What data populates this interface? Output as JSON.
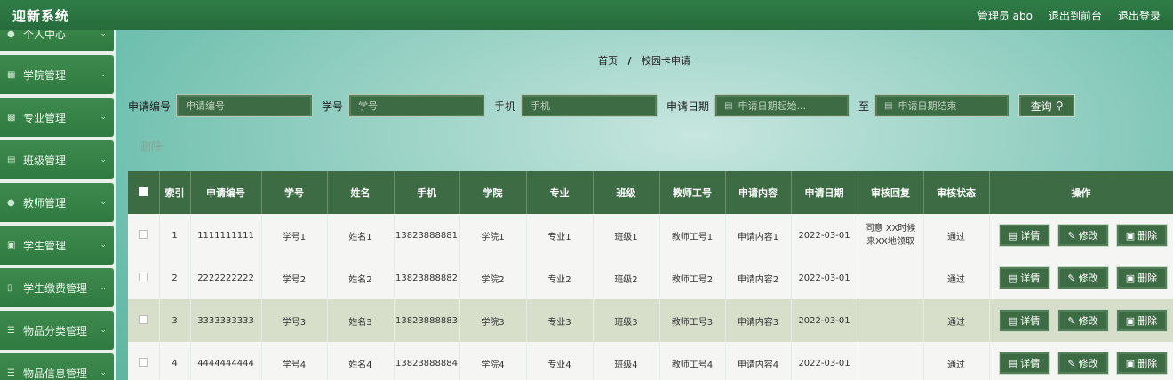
{
  "header": {
    "app_title": "迎新系统",
    "admin_label": "管理员 abo",
    "exit_front": "退出到前台",
    "logout": "退出登录"
  },
  "sidebar": {
    "items": [
      {
        "label": "个人中心",
        "icon": "user-icon"
      },
      {
        "label": "学院管理",
        "icon": "grid-icon"
      },
      {
        "label": "专业管理",
        "icon": "clipboard-icon"
      },
      {
        "label": "班级管理",
        "icon": "list-icon"
      },
      {
        "label": "教师管理",
        "icon": "user-icon"
      },
      {
        "label": "学生管理",
        "icon": "chat-icon"
      },
      {
        "label": "学生缴费管理",
        "icon": "bar-chart-icon"
      },
      {
        "label": "物品分类管理",
        "icon": "menu-icon"
      },
      {
        "label": "物品信息管理",
        "icon": "menu-icon"
      }
    ]
  },
  "breadcrumb": {
    "home": "首页",
    "sep": "/",
    "current": "校园卡申请"
  },
  "search": {
    "app_no_label": "申请编号",
    "app_no_placeholder": "申请编号",
    "student_no_label": "学号",
    "student_no_placeholder": "学号",
    "phone_label": "手机",
    "phone_placeholder": "手机",
    "date_label": "申请日期",
    "date_start_placeholder": "申请日期起始...",
    "to_label": "至",
    "date_end_placeholder": "申请日期结束",
    "query_button": "查询"
  },
  "actions": {
    "delete_label": "删除"
  },
  "table": {
    "columns": [
      "索引",
      "申请编号",
      "学号",
      "姓名",
      "手机",
      "学院",
      "专业",
      "班级",
      "教师工号",
      "申请内容",
      "申请日期",
      "审核回复",
      "审核状态",
      "操作"
    ],
    "rows": [
      {
        "index": "1",
        "app_no": "1111111111",
        "student_no": "学号1",
        "name": "姓名1",
        "phone": "13823888881",
        "college": "学院1",
        "major": "专业1",
        "class": "班级1",
        "teacher_no": "教师工号1",
        "content": "申请内容1",
        "date": "2022-03-01",
        "reply_line1": "同意 XX时候",
        "reply_line2": "来XX地领取",
        "status": "通过"
      },
      {
        "index": "2",
        "app_no": "2222222222",
        "student_no": "学号2",
        "name": "姓名2",
        "phone": "13823888882",
        "college": "学院2",
        "major": "专业2",
        "class": "班级2",
        "teacher_no": "教师工号2",
        "content": "申请内容2",
        "date": "2022-03-01",
        "reply_line1": "",
        "reply_line2": "",
        "status": "通过"
      },
      {
        "index": "3",
        "app_no": "3333333333",
        "student_no": "学号3",
        "name": "姓名3",
        "phone": "13823888883",
        "college": "学院3",
        "major": "专业3",
        "class": "班级3",
        "teacher_no": "教师工号3",
        "content": "申请内容3",
        "date": "2022-03-01",
        "reply_line1": "",
        "reply_line2": "",
        "status": "通过"
      },
      {
        "index": "4",
        "app_no": "4444444444",
        "student_no": "学号4",
        "name": "姓名4",
        "phone": "13823888884",
        "college": "学院4",
        "major": "专业4",
        "class": "班级4",
        "teacher_no": "教师工号4",
        "content": "申请内容4",
        "date": "2022-03-01",
        "reply_line1": "",
        "reply_line2": "",
        "status": "通过"
      }
    ],
    "op_detail": "详情",
    "op_edit": "修改",
    "op_delete": "删除"
  }
}
